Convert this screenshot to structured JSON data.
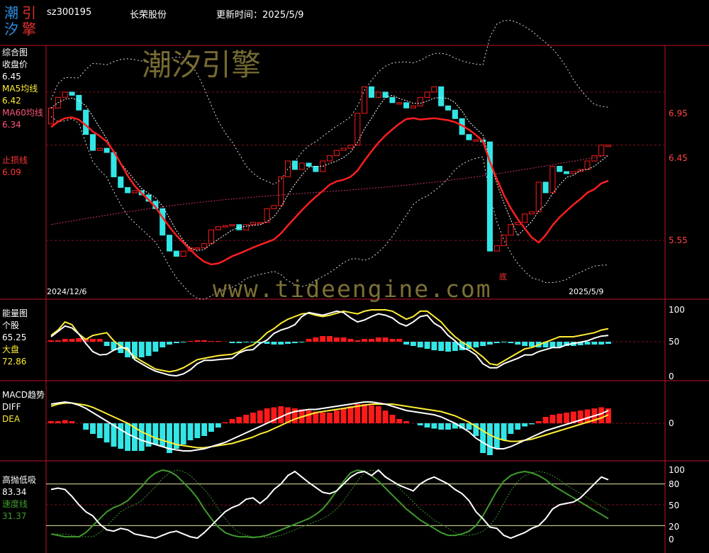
{
  "header": {
    "logo": [
      "潮",
      "引",
      "汐",
      "擎"
    ],
    "code": "sz300195",
    "name": "长荣股份",
    "time_label": "更新时间：2025/5/9"
  },
  "watermarks": [
    "潮汐引擎",
    "www.tideengine.com"
  ],
  "colors": {
    "up": "#ff1a1a",
    "down": "#33e6e6",
    "white": "#ffffff",
    "yellow": "#ffee33",
    "green": "#3f9b2c",
    "pink": "#cc3366",
    "border": "#c0102a"
  },
  "chart_data": [
    {
      "id": "main",
      "type": "candlestick",
      "panel_title": "综合图",
      "legend": [
        {
          "label": "收盘价",
          "value": "6.45",
          "color": "#ffffff"
        },
        {
          "label": "MA5均线",
          "value": "6.42",
          "color": "#ffee33"
        },
        {
          "label": "MA60均线",
          "value": "6.34",
          "color": "#ff5577"
        },
        {
          "label": "止损线",
          "value": "6.09",
          "color": "#ff3333"
        }
      ],
      "y_ticks": [
        "6.95",
        "6.45",
        "5.55"
      ],
      "x_labels": [
        "2024/12/6",
        "2025/5/9"
      ],
      "marker": "底",
      "close": [
        6.8,
        6.9,
        6.95,
        6.92,
        6.78,
        6.55,
        6.4,
        6.42,
        6.38,
        6.15,
        6.05,
        6.0,
        6.02,
        5.98,
        5.92,
        5.85,
        5.6,
        5.45,
        5.4,
        5.45,
        5.48,
        5.48,
        5.52,
        5.65,
        5.68,
        5.69,
        5.7,
        5.65,
        5.7,
        5.72,
        5.72,
        5.85,
        5.88,
        6.15,
        6.3,
        6.22,
        6.28,
        6.25,
        6.2,
        6.3,
        6.35,
        6.4,
        6.42,
        6.45,
        6.75,
        7.0,
        6.9,
        6.95,
        6.9,
        6.85,
        6.85,
        6.8,
        6.82,
        6.9,
        6.95,
        7.0,
        6.82,
        6.78,
        6.7,
        6.55,
        6.5,
        6.5,
        6.48,
        5.45,
        5.5,
        5.6,
        5.7,
        5.72,
        5.8,
        5.82,
        6.1,
        6.0,
        6.25,
        6.2,
        6.18,
        6.2,
        6.22,
        6.3,
        6.35,
        6.45,
        6.45
      ]
    },
    {
      "id": "energy",
      "type": "line+bar",
      "panel_title": "能量图",
      "legend": [
        {
          "label": "个股",
          "value": "65.25",
          "color": "#ffffff"
        },
        {
          "label": "大盘",
          "value": "72.86",
          "color": "#ffee33"
        }
      ],
      "y_ticks": [
        "100",
        "50",
        "0"
      ],
      "stock": [
        60,
        68,
        76,
        73,
        64,
        50,
        38,
        33,
        34,
        40,
        44,
        43,
        26,
        20,
        14,
        9,
        6,
        3,
        2,
        5,
        11,
        20,
        25,
        25,
        26,
        27,
        28,
        36,
        40,
        41,
        50,
        55,
        65,
        70,
        73,
        78,
        90,
        96,
        94,
        92,
        95,
        98,
        96,
        88,
        82,
        85,
        90,
        94,
        92,
        88,
        80,
        76,
        82,
        90,
        92,
        80,
        74,
        62,
        54,
        44,
        40,
        33,
        20,
        14,
        14,
        20,
        24,
        28,
        33,
        33,
        38,
        41,
        44,
        44,
        48,
        50,
        52,
        54,
        58,
        61,
        62
      ],
      "index": [
        62,
        70,
        82,
        78,
        64,
        56,
        62,
        64,
        66,
        54,
        46,
        40,
        30,
        24,
        18,
        12,
        10,
        8,
        10,
        14,
        20,
        26,
        28,
        30,
        32,
        33,
        34,
        38,
        44,
        48,
        56,
        66,
        72,
        80,
        86,
        90,
        94,
        95,
        92,
        90,
        92,
        95,
        98,
        96,
        94,
        98,
        100,
        102,
        100,
        98,
        92,
        86,
        90,
        98,
        98,
        90,
        82,
        70,
        60,
        52,
        46,
        38,
        30,
        20,
        18,
        24,
        30,
        36,
        42,
        44,
        48,
        52,
        56,
        60,
        60,
        60,
        62,
        64,
        66,
        70,
        72
      ],
      "bars": [
        2,
        2,
        4,
        4,
        5,
        4,
        4,
        4,
        -6,
        -12,
        -16,
        -22,
        -24,
        -22,
        -20,
        -14,
        -8,
        -4,
        -2,
        -1,
        1,
        2,
        2,
        1,
        1,
        0,
        -2,
        -2,
        -1,
        -1,
        -2,
        -3,
        -4,
        -4,
        -3,
        -2,
        -1,
        4,
        6,
        8,
        8,
        6,
        6,
        4,
        2,
        4,
        4,
        6,
        6,
        4,
        4,
        -4,
        -6,
        -8,
        -10,
        -12,
        -13,
        -14,
        -13,
        -12,
        -10,
        -8,
        -6,
        -4,
        -2,
        -1,
        -2,
        -4,
        -6,
        -7,
        -8,
        -8,
        -8,
        -7,
        -6,
        -6,
        -5,
        -4,
        -4,
        -4,
        -3
      ]
    },
    {
      "id": "macd",
      "type": "line+bar",
      "panel_title": "MACD趋势",
      "legend": [
        {
          "label": "DIFF",
          "value": "",
          "color": "#ffffff"
        },
        {
          "label": "DEA",
          "value": "",
          "color": "#ffee33"
        }
      ],
      "y_ticks": [
        "0"
      ],
      "diff": [
        0.18,
        0.19,
        0.2,
        0.19,
        0.17,
        0.14,
        0.1,
        0.06,
        0.02,
        -0.02,
        -0.06,
        -0.1,
        -0.13,
        -0.16,
        -0.18,
        -0.2,
        -0.22,
        -0.24,
        -0.25,
        -0.26,
        -0.26,
        -0.25,
        -0.24,
        -0.22,
        -0.2,
        -0.18,
        -0.15,
        -0.12,
        -0.09,
        -0.06,
        -0.03,
        0.0,
        0.03,
        0.06,
        0.09,
        0.11,
        0.12,
        0.13,
        0.13,
        0.14,
        0.15,
        0.16,
        0.17,
        0.18,
        0.19,
        0.2,
        0.2,
        0.19,
        0.18,
        0.16,
        0.14,
        0.12,
        0.11,
        0.1,
        0.09,
        0.08,
        0.06,
        0.03,
        0.0,
        -0.04,
        -0.08,
        -0.14,
        -0.18,
        -0.22,
        -0.24,
        -0.24,
        -0.22,
        -0.19,
        -0.16,
        -0.13,
        -0.1,
        -0.07,
        -0.05,
        -0.03,
        -0.01,
        0.01,
        0.03,
        0.05,
        0.07,
        0.09,
        0.12
      ],
      "dea": [
        0.16,
        0.18,
        0.19,
        0.19,
        0.18,
        0.17,
        0.15,
        0.12,
        0.09,
        0.06,
        0.03,
        0.0,
        -0.04,
        -0.08,
        -0.11,
        -0.14,
        -0.16,
        -0.18,
        -0.2,
        -0.21,
        -0.22,
        -0.23,
        -0.23,
        -0.22,
        -0.21,
        -0.2,
        -0.19,
        -0.17,
        -0.15,
        -0.13,
        -0.1,
        -0.08,
        -0.05,
        -0.02,
        0.01,
        0.04,
        0.06,
        0.08,
        0.1,
        0.11,
        0.12,
        0.13,
        0.14,
        0.15,
        0.16,
        0.17,
        0.18,
        0.18,
        0.18,
        0.18,
        0.17,
        0.16,
        0.15,
        0.14,
        0.13,
        0.12,
        0.11,
        0.09,
        0.07,
        0.04,
        0.01,
        -0.03,
        -0.07,
        -0.11,
        -0.14,
        -0.16,
        -0.17,
        -0.17,
        -0.16,
        -0.15,
        -0.13,
        -0.11,
        -0.09,
        -0.07,
        -0.05,
        -0.03,
        -0.01,
        0.01,
        0.03,
        0.05,
        0.08
      ],
      "bars": [
        0.02,
        0.02,
        0.03,
        0.02,
        0.0,
        -0.06,
        -0.1,
        -0.14,
        -0.18,
        -0.22,
        -0.24,
        -0.26,
        -0.26,
        -0.26,
        -0.22,
        -0.2,
        -0.22,
        -0.28,
        -0.24,
        -0.2,
        -0.16,
        -0.14,
        -0.12,
        -0.08,
        -0.04,
        0.01,
        0.04,
        0.06,
        0.08,
        0.1,
        0.12,
        0.14,
        0.15,
        0.16,
        0.15,
        0.14,
        0.13,
        0.12,
        0.11,
        0.1,
        0.1,
        0.12,
        0.14,
        0.16,
        0.18,
        0.18,
        0.17,
        0.16,
        0.12,
        0.08,
        0.04,
        0.02,
        0.0,
        -0.02,
        -0.04,
        -0.05,
        -0.06,
        -0.06,
        -0.05,
        -0.05,
        -0.06,
        -0.12,
        -0.28,
        -0.3,
        -0.24,
        -0.16,
        -0.1,
        -0.06,
        -0.03,
        -0.01,
        0.02,
        0.06,
        0.08,
        0.09,
        0.1,
        0.11,
        0.12,
        0.13,
        0.14,
        0.15,
        0.14
      ]
    },
    {
      "id": "oscillator",
      "type": "line",
      "panel_title": "高抛低吸",
      "legend": [
        {
          "label": "",
          "value": "83.34",
          "color": "#ffffff"
        },
        {
          "label": "速度线",
          "value": "31.37",
          "color": "#3f9b2c"
        }
      ],
      "y_ticks": [
        "100",
        "80",
        "50",
        "20",
        "0"
      ],
      "white": [
        72,
        74,
        72,
        62,
        50,
        40,
        34,
        22,
        14,
        12,
        16,
        14,
        8,
        6,
        4,
        2,
        6,
        10,
        12,
        8,
        4,
        2,
        10,
        20,
        30,
        40,
        46,
        50,
        58,
        60,
        52,
        60,
        72,
        80,
        92,
        98,
        90,
        82,
        75,
        68,
        66,
        70,
        80,
        90,
        96,
        98,
        92,
        100,
        90,
        84,
        78,
        74,
        70,
        80,
        86,
        90,
        85,
        80,
        72,
        66,
        56,
        40,
        30,
        18,
        16,
        6,
        2,
        6,
        10,
        16,
        20,
        30,
        44,
        50,
        52,
        54,
        60,
        70,
        80,
        90,
        86
      ],
      "green": [
        8,
        6,
        4,
        4,
        4,
        10,
        20,
        30,
        40,
        46,
        50,
        56,
        66,
        76,
        88,
        96,
        100,
        98,
        92,
        82,
        72,
        60,
        44,
        30,
        18,
        10,
        6,
        4,
        4,
        3,
        4,
        6,
        10,
        14,
        18,
        22,
        26,
        30,
        36,
        44,
        56,
        70,
        84,
        96,
        100,
        98,
        92,
        84,
        74,
        64,
        54,
        44,
        36,
        28,
        22,
        16,
        10,
        6,
        6,
        8,
        12,
        20,
        34,
        52,
        70,
        84,
        92,
        96,
        98,
        96,
        92,
        86,
        78,
        72,
        66,
        60,
        54,
        48,
        42,
        36,
        30
      ]
    }
  ]
}
